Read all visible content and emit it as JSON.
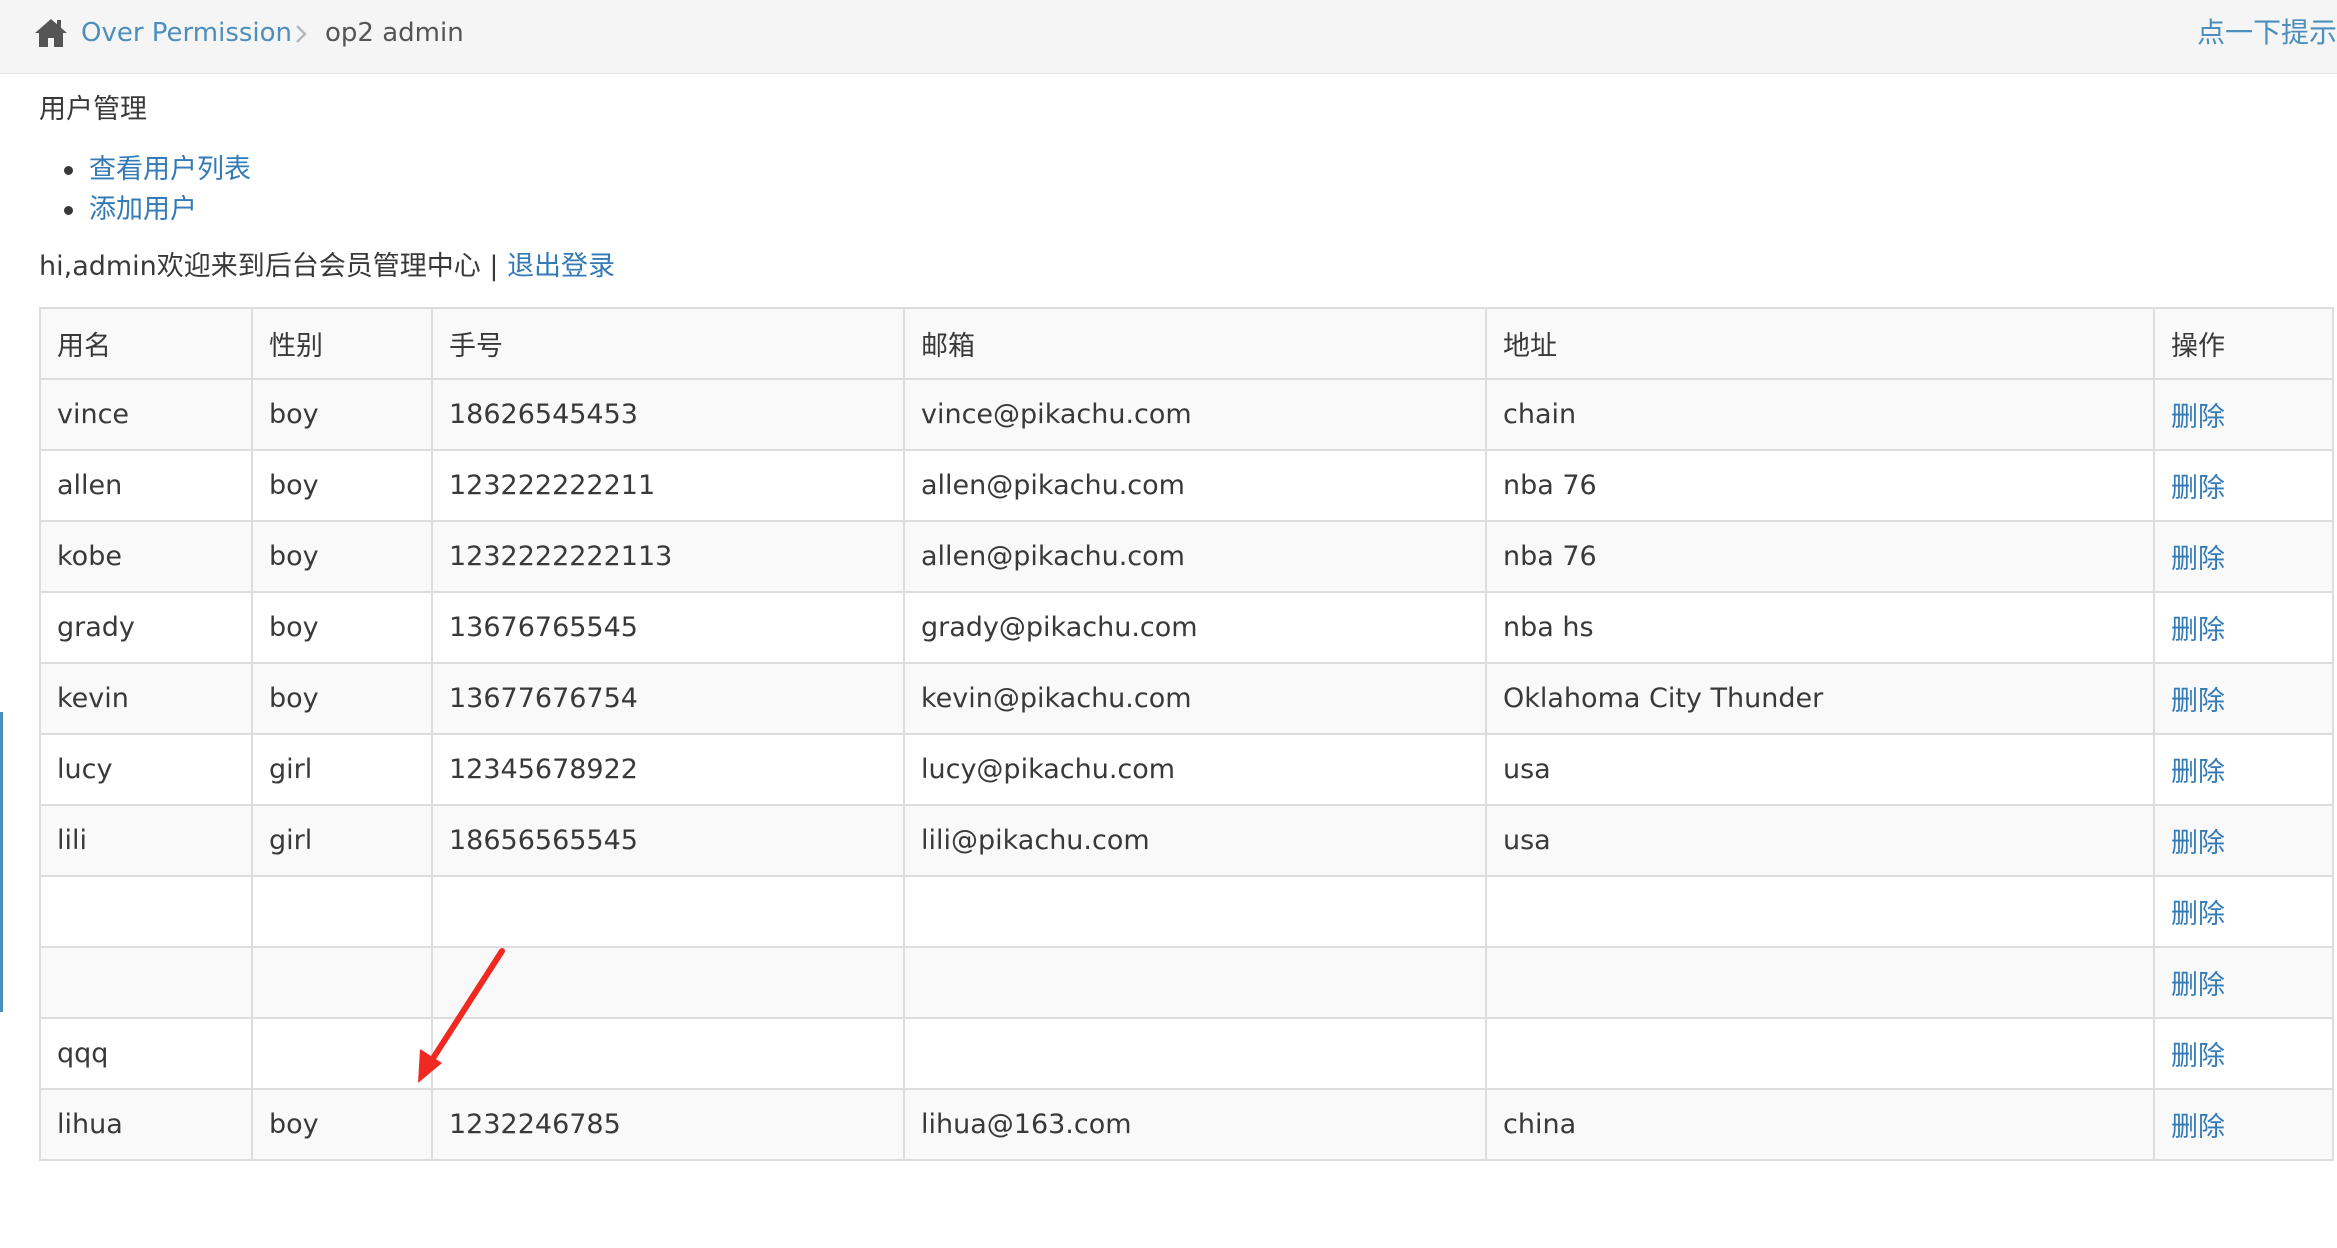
{
  "breadcrumb": {
    "home_icon": "home-icon",
    "link": "Over Permission",
    "separator_icon": "chevron-right-icon",
    "current": "op2 admin"
  },
  "hint": "点一下提示",
  "section_title": "用户管理",
  "menu": [
    {
      "label": "查看用户列表"
    },
    {
      "label": "添加用户"
    }
  ],
  "welcome": {
    "text": "hi,admin欢迎来到后台会员管理中心 | ",
    "logout": "退出登录"
  },
  "table": {
    "headers": [
      "用名",
      "性别",
      "手号",
      "邮箱",
      "地址",
      "操作"
    ],
    "rows": [
      {
        "name": "vince",
        "sex": "boy",
        "phone": "18626545453",
        "email": "vince@pikachu.com",
        "address": "chain",
        "action": "删除"
      },
      {
        "name": "allen",
        "sex": "boy",
        "phone": "123222222211",
        "email": "allen@pikachu.com",
        "address": "nba 76",
        "action": "删除"
      },
      {
        "name": "kobe",
        "sex": "boy",
        "phone": "1232222222113",
        "email": "allen@pikachu.com",
        "address": "nba 76",
        "action": "删除"
      },
      {
        "name": "grady",
        "sex": "boy",
        "phone": "13676765545",
        "email": "grady@pikachu.com",
        "address": "nba hs",
        "action": "删除"
      },
      {
        "name": "kevin",
        "sex": "boy",
        "phone": "13677676754",
        "email": "kevin@pikachu.com",
        "address": "Oklahoma City Thunder",
        "action": "删除"
      },
      {
        "name": "lucy",
        "sex": "girl",
        "phone": "12345678922",
        "email": "lucy@pikachu.com",
        "address": "usa",
        "action": "删除"
      },
      {
        "name": "lili",
        "sex": "girl",
        "phone": "18656565545",
        "email": "lili@pikachu.com",
        "address": "usa",
        "action": "删除"
      },
      {
        "name": "",
        "sex": "",
        "phone": "",
        "email": "",
        "address": "",
        "action": "删除"
      },
      {
        "name": "",
        "sex": "",
        "phone": "",
        "email": "",
        "address": "",
        "action": "删除"
      },
      {
        "name": "qqq",
        "sex": "",
        "phone": "",
        "email": "",
        "address": "",
        "action": "删除"
      },
      {
        "name": "lihua",
        "sex": "boy",
        "phone": "1232246785",
        "email": "lihua@163.com",
        "address": "china",
        "action": "删除"
      }
    ]
  },
  "annotation": {
    "icon": "red-arrow-icon",
    "color": "#f02a22"
  },
  "colors": {
    "link": "#337ab7",
    "breadcrumb_link": "#4c8fbd",
    "border": "#dddddd"
  }
}
